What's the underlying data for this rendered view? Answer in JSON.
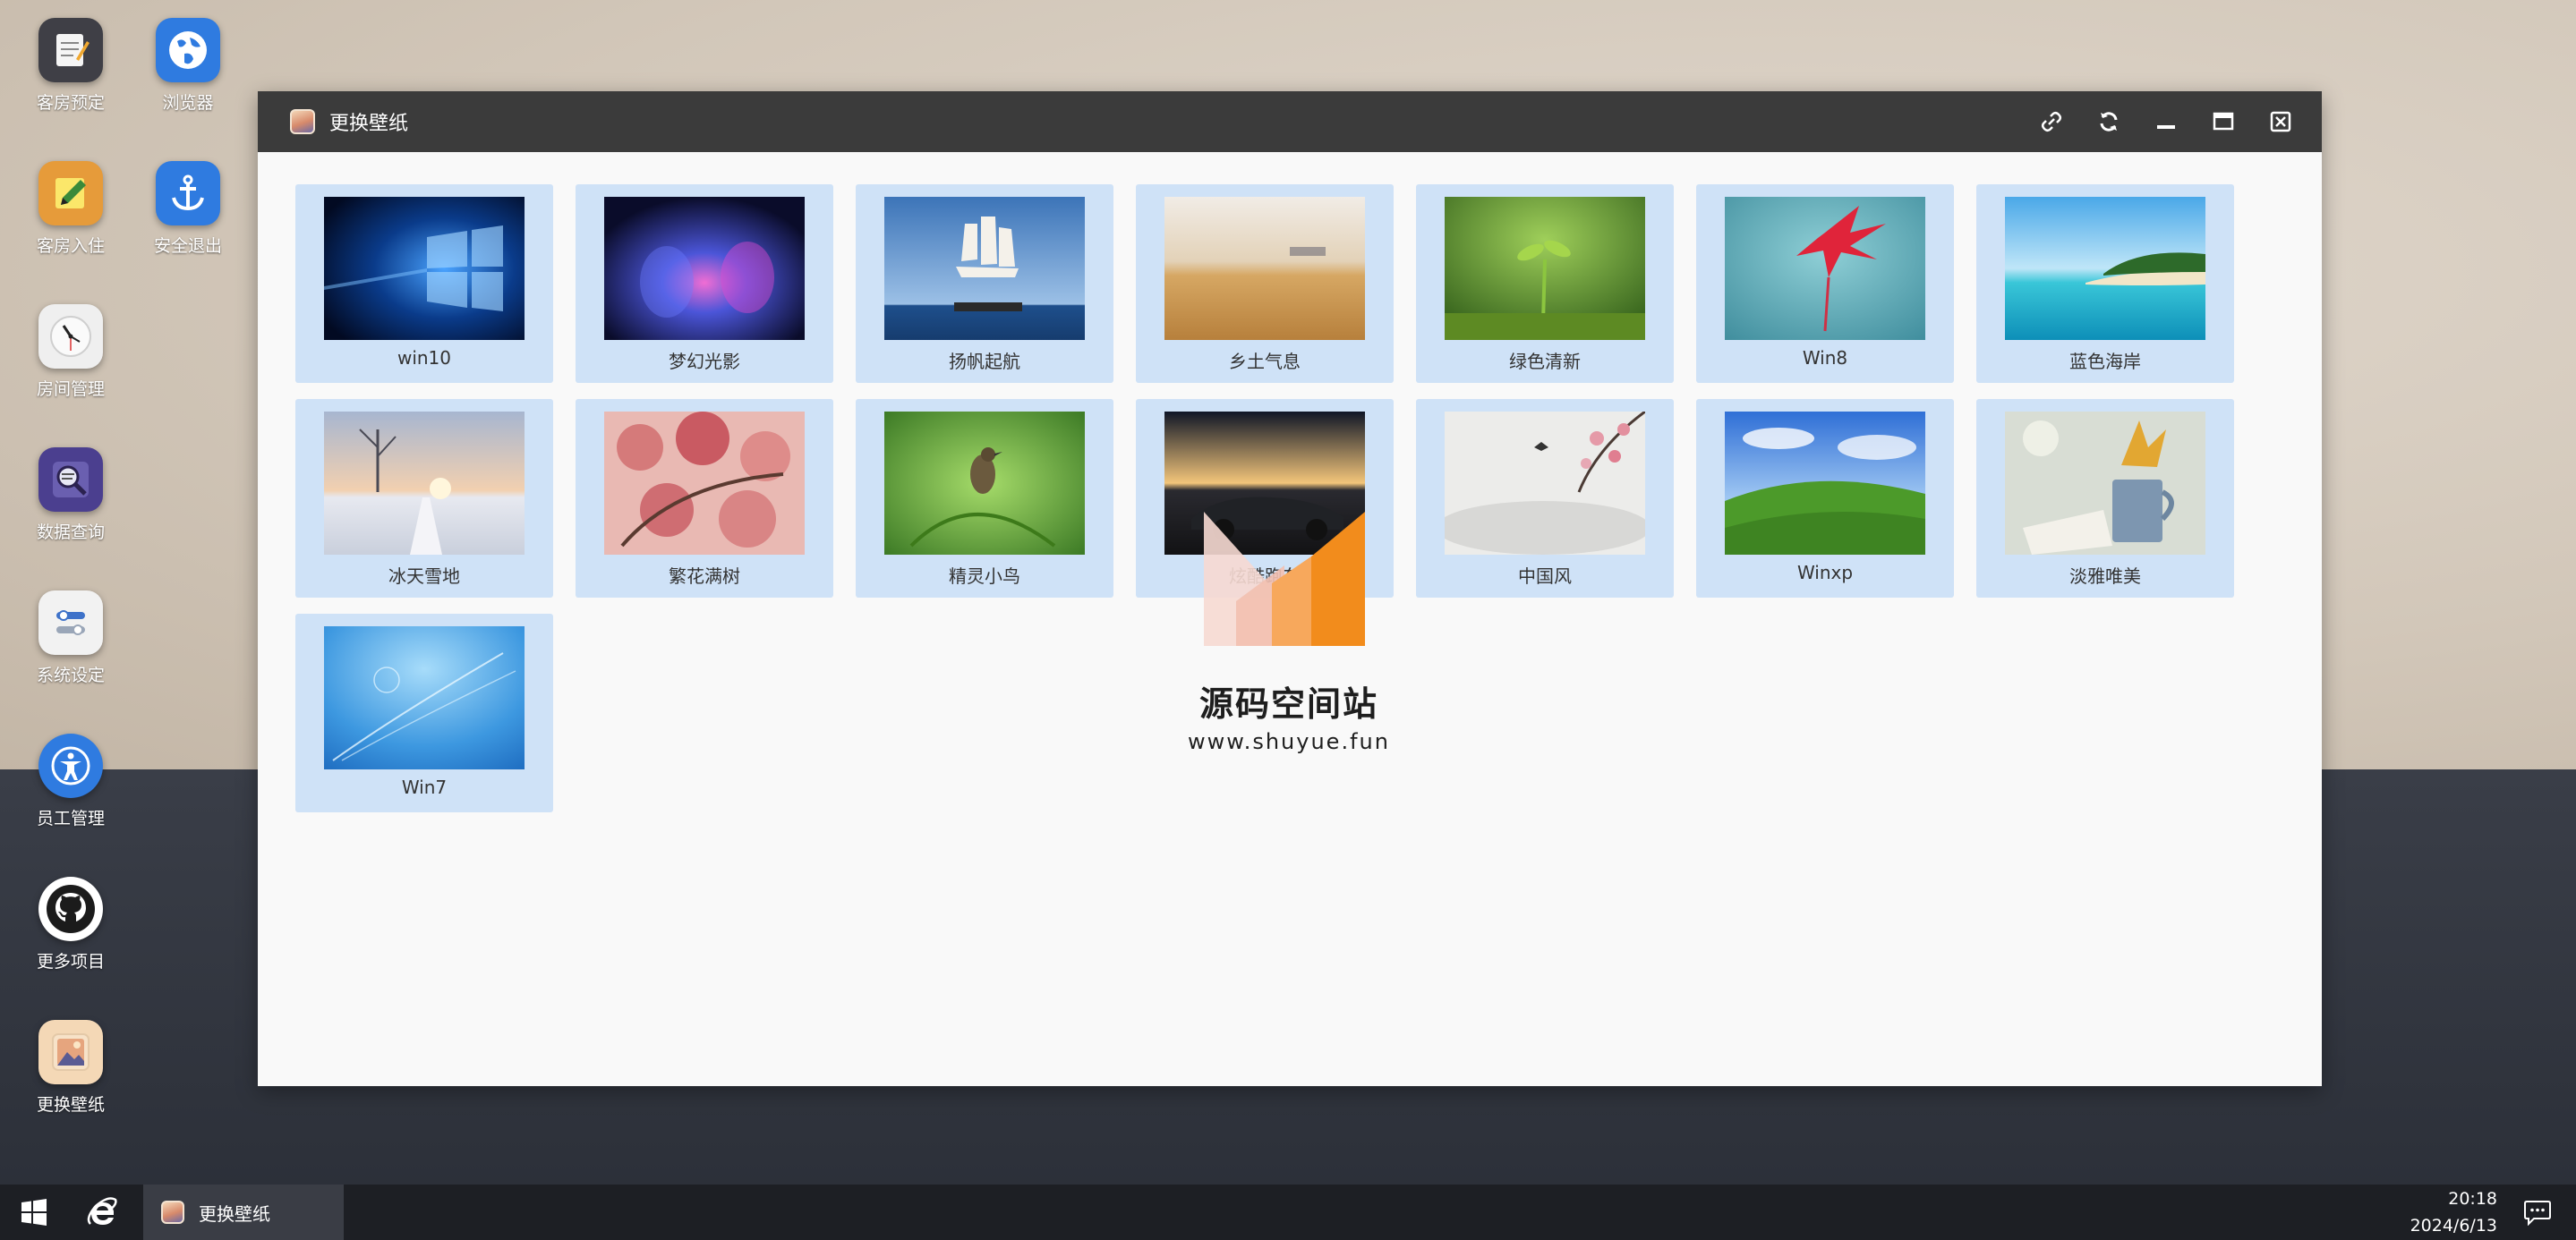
{
  "desktop_icons": [
    {
      "label": "客房预定",
      "icon": "notepad-icon"
    },
    {
      "label": "浏览器",
      "icon": "globe-icon"
    },
    {
      "label": "客房入住",
      "icon": "pencil-note-icon"
    },
    {
      "label": "安全退出",
      "icon": "anchor-icon"
    },
    {
      "label": "房间管理",
      "icon": "clock-icon"
    },
    {
      "label": "数据查询",
      "icon": "magnifier-icon"
    },
    {
      "label": "系统设定",
      "icon": "toggle-icon"
    },
    {
      "label": "员工管理",
      "icon": "accessibility-icon"
    },
    {
      "label": "更多项目",
      "icon": "github-icon"
    },
    {
      "label": "更换壁纸",
      "icon": "wallpaper-icon"
    }
  ],
  "window": {
    "title": "更换壁纸",
    "controls": [
      "link-icon",
      "refresh-icon",
      "minimize-icon",
      "maximize-icon",
      "close-icon"
    ]
  },
  "wallpapers": [
    {
      "label": "win10",
      "theme": "win10"
    },
    {
      "label": "梦幻光影",
      "theme": "dream"
    },
    {
      "label": "扬帆起航",
      "theme": "sail"
    },
    {
      "label": "乡土气息",
      "theme": "wheat"
    },
    {
      "label": "绿色清新",
      "theme": "sprout"
    },
    {
      "label": "Win8",
      "theme": "win8"
    },
    {
      "label": "蓝色海岸",
      "theme": "beach"
    },
    {
      "label": "冰天雪地",
      "theme": "snow"
    },
    {
      "label": "繁花满树",
      "theme": "blossom"
    },
    {
      "label": "精灵小鸟",
      "theme": "bird"
    },
    {
      "label": "炫酷跑车",
      "theme": "car"
    },
    {
      "label": "中国风",
      "theme": "chinese"
    },
    {
      "label": "Winxp",
      "theme": "winxp"
    },
    {
      "label": "淡雅唯美",
      "theme": "cup"
    },
    {
      "label": "Win7",
      "theme": "win7"
    }
  ],
  "watermark": {
    "title": "源码空间站",
    "url": "www.shuyue.fun"
  },
  "taskbar": {
    "start_icon": "windows-start-icon",
    "browser_icon": "ie-browser-icon",
    "task_label": "更换壁纸",
    "time": "20:18",
    "date": "2024/6/13",
    "message_icon": "message-icon"
  },
  "colors": {
    "card_bg": "#cfe2f7",
    "titlebar": "#3b3b3b",
    "taskbar": "#1d1f24"
  }
}
